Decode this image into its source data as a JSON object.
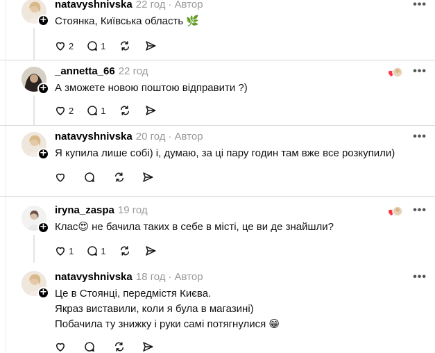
{
  "icons": {
    "like": "heart-icon",
    "reply": "comment-icon",
    "repost": "repost-icon",
    "share": "send-icon",
    "more": "more-icon",
    "follow": "plus-icon"
  },
  "follow_symbol": "+",
  "more_symbol": "•••",
  "separator": "·",
  "comments": [
    {
      "username": "natavyshnivska",
      "time": "22 год",
      "author_label": "Автор",
      "text": "Стоянка, Київська область 🌿",
      "likes": "2",
      "replies": "1"
    },
    {
      "username": "_annetta_66",
      "time": "22 год",
      "text": "А зможете новою поштою відправити ?)",
      "likes": "2",
      "replies": "1"
    },
    {
      "username": "natavyshnivska",
      "time": "20 год",
      "author_label": "Автор",
      "text": "Я купила лише собі) і, думаю, за ці пару годин там вже все розкупили)"
    },
    {
      "username": "iryna_zaspa",
      "time": "19 год",
      "text": "Клас😍 не бачила таких в себе в місті, це ви де знайшли?",
      "likes": "1",
      "replies": "1"
    },
    {
      "username": "natavyshnivska",
      "time": "18 год",
      "author_label": "Автор",
      "text_lines": [
        "Це в Стоянці, передмістя Києва.",
        "Якраз виставили, коли я була в магазині)",
        "Побачила ту знижку і руки самі потягнулися 😁"
      ]
    }
  ]
}
